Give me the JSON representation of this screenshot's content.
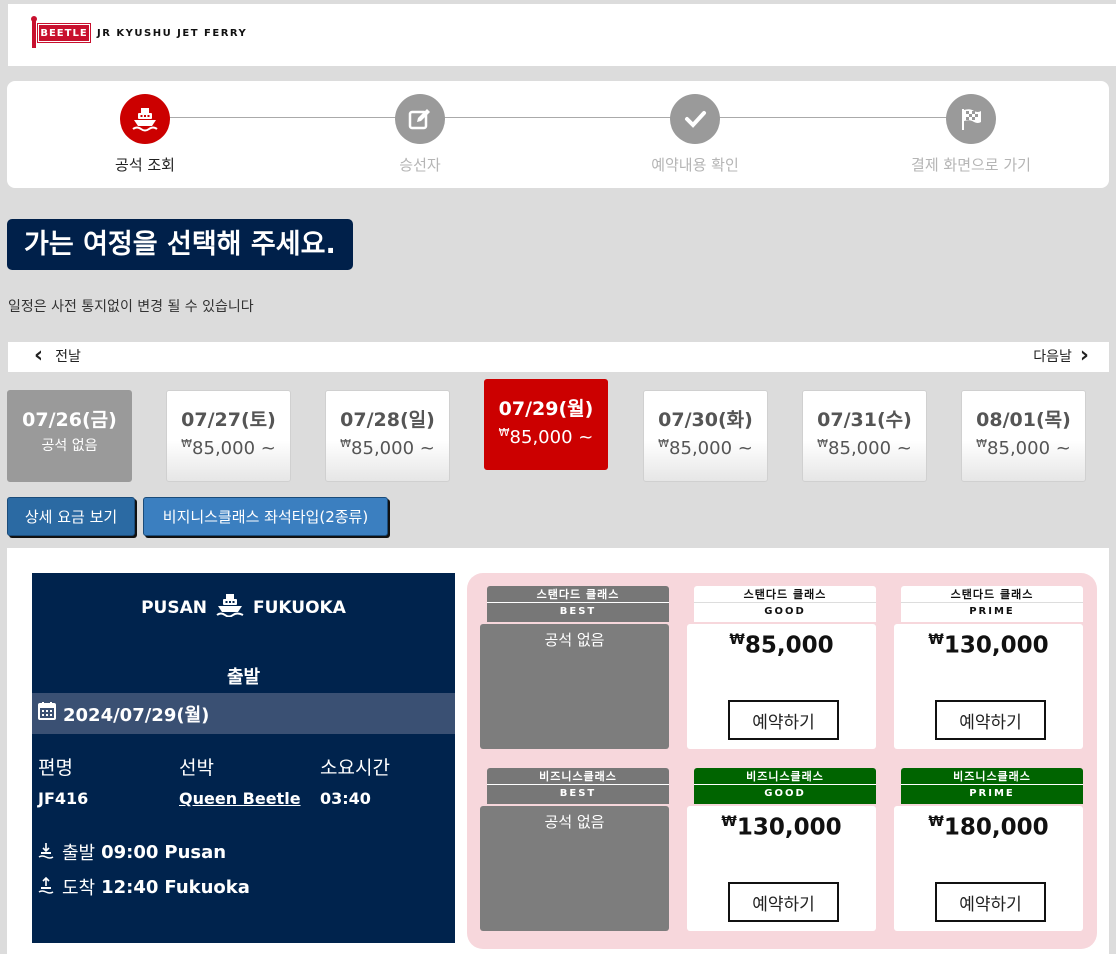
{
  "header": {
    "logo_badge": "BEETLE",
    "logo_text": "JR KYUSHU JET FERRY"
  },
  "steps": [
    {
      "label": "공석 조회",
      "icon": "ship-icon",
      "active": true
    },
    {
      "label": "승선자",
      "icon": "edit-icon",
      "active": false
    },
    {
      "label": "예약내용 확인",
      "icon": "check-icon",
      "active": false
    },
    {
      "label": "결제 화면으로 가기",
      "icon": "checkered-flag-icon",
      "active": false
    }
  ],
  "page_title": "가는 여정을 선택해 주세요.",
  "notice": "일정은 사전 통지없이 변경 될 수 있습니다",
  "day_nav": {
    "prev": "전날",
    "next": "다음날"
  },
  "dates": [
    {
      "date": "07/26(금)",
      "price": "공석 없음",
      "state": "soldout"
    },
    {
      "date": "07/27(토)",
      "currency": "₩",
      "price": "85,000 ~",
      "state": "normal"
    },
    {
      "date": "07/28(일)",
      "currency": "₩",
      "price": "85,000 ~",
      "state": "normal"
    },
    {
      "date": "07/29(월)",
      "currency": "₩",
      "price": "85,000 ~",
      "state": "selected"
    },
    {
      "date": "07/30(화)",
      "currency": "₩",
      "price": "85,000 ~",
      "state": "normal"
    },
    {
      "date": "07/31(수)",
      "currency": "₩",
      "price": "85,000 ~",
      "state": "normal"
    },
    {
      "date": "08/01(목)",
      "currency": "₩",
      "price": "85,000 ~",
      "state": "normal"
    }
  ],
  "buttons": {
    "fare_detail": "상세 요금 보기",
    "business_seat_types": "비지니스클래스 좌석타입(2종류)"
  },
  "voyage": {
    "from": "PUSAN",
    "to": "FUKUOKA",
    "direction_label": "출발",
    "date": "2024/07/29(월)",
    "headers": {
      "flight": "편명",
      "ship": "선박",
      "duration": "소요시간"
    },
    "flight": "JF416",
    "ship": "Queen Beetle",
    "duration": "03:40",
    "departure": {
      "label": "출발",
      "time": "09:00",
      "port": "Pusan"
    },
    "arrival": {
      "label": "도착",
      "time": "12:40",
      "port": "Fukuoka"
    }
  },
  "fares": {
    "standard": [
      {
        "class": "스탠다드 클래스",
        "grade": "BEST",
        "available": false,
        "sold_out": "공석 없음"
      },
      {
        "class": "스탠다드 클래스",
        "grade": "GOOD",
        "available": true,
        "currency": "₩",
        "price": "85,000",
        "button": "예약하기"
      },
      {
        "class": "스탠다드 클래스",
        "grade": "PRIME",
        "available": true,
        "currency": "₩",
        "price": "130,000",
        "button": "예약하기"
      }
    ],
    "business": [
      {
        "class": "비즈니스클래스",
        "grade": "BEST",
        "available": false,
        "sold_out": "공석 없음"
      },
      {
        "class": "비즈니스클래스",
        "grade": "GOOD",
        "available": true,
        "currency": "₩",
        "price": "130,000",
        "button": "예약하기"
      },
      {
        "class": "비즈니스클래스",
        "grade": "PRIME",
        "available": true,
        "currency": "₩",
        "price": "180,000",
        "button": "예약하기"
      }
    ]
  },
  "colors": {
    "brand_red": "#cc0000",
    "navy": "#00234d",
    "business_green": "#006400",
    "fare_panel_pink": "#f7d7dc",
    "button_blue": "#2b6aa3"
  }
}
